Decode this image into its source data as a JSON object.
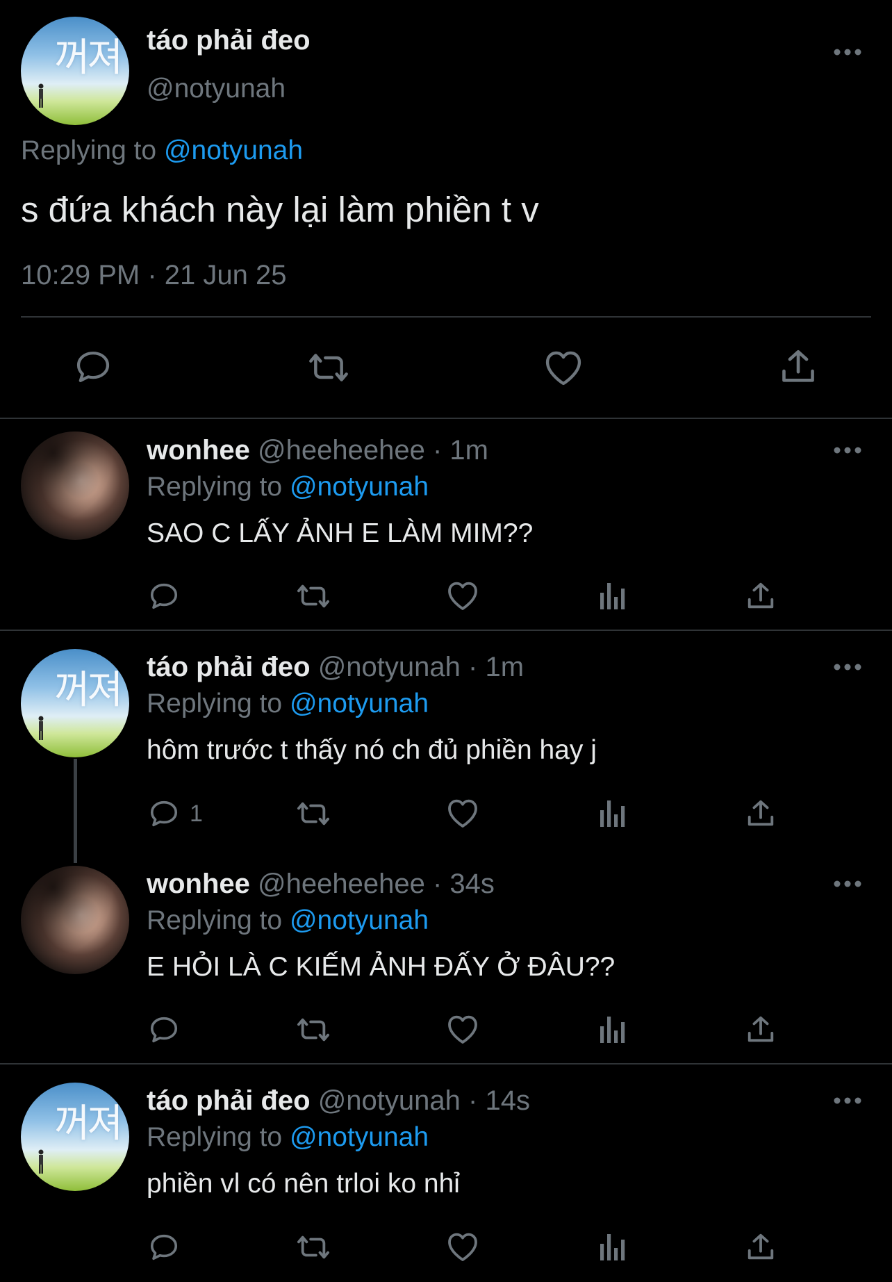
{
  "main_tweet": {
    "display_name": "táo phải đeo",
    "handle": "@notyunah",
    "replying_prefix": "Replying to",
    "replying_handle": "@notyunah",
    "text": "s đứa khách này lại làm phiền t v",
    "timestamp": "10:29 PM · 21 Jun 25",
    "avatar_text": "꺼져"
  },
  "replies": [
    {
      "display_name": "wonhee",
      "handle_time": "@heeheehee · 1m",
      "replying_prefix": "Replying to",
      "replying_handle": "@notyunah",
      "text": "SAO C LẤY ẢNH E LÀM MIM??",
      "reply_count": ""
    },
    {
      "display_name": "táo phải đeo",
      "handle_time": "@notyunah · 1m",
      "replying_prefix": "Replying to",
      "replying_handle": "@notyunah",
      "text": "hôm trước t thấy nó ch đủ phiền hay j",
      "reply_count": "1",
      "avatar_text": "꺼져"
    },
    {
      "display_name": "wonhee",
      "handle_time": "@heeheehee · 34s",
      "replying_prefix": "Replying to",
      "replying_handle": "@notyunah",
      "text": "E HỎI LÀ C KIẾM ẢNH ĐẤY Ở ĐÂU??",
      "reply_count": ""
    },
    {
      "display_name": "táo phải đeo",
      "handle_time": "@notyunah · 14s",
      "replying_prefix": "Replying to",
      "replying_handle": "@notyunah",
      "text": "phiền vl có nên trloi ko nhỉ",
      "reply_count": "",
      "avatar_text": "꺼져"
    }
  ],
  "colors": {
    "background": "#000000",
    "text": "#e7e9ea",
    "secondary": "#6e767d",
    "link": "#1d9bf0",
    "divider": "#2f3336"
  },
  "icons": [
    "reply-icon",
    "retweet-icon",
    "like-icon",
    "views-icon",
    "share-icon",
    "more-icon"
  ]
}
